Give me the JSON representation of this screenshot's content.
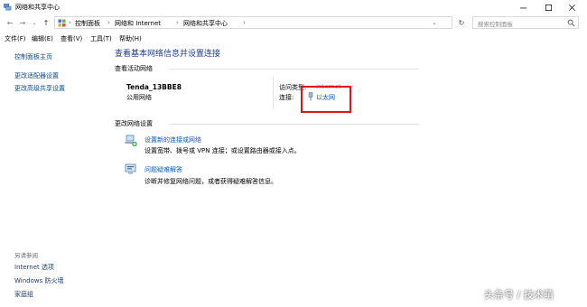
{
  "window": {
    "title": "网络和共享中心"
  },
  "address": {
    "crumbs": [
      "控制面板",
      "网络和 Internet",
      "网络和共享中心"
    ],
    "search_placeholder": "搜索控制面板"
  },
  "menu": {
    "items": [
      "文件(F)",
      "编辑(E)",
      "查看(V)",
      "工具(T)",
      "帮助(H)"
    ]
  },
  "sidebar": {
    "links": [
      "控制面板主页",
      "更改适配器设置",
      "更改高级共享设置"
    ],
    "see_also_heading": "另请参阅",
    "see_also": [
      "Internet 选项",
      "Windows 防火墙",
      "家庭组"
    ]
  },
  "main": {
    "title": "查看基本网络信息并设置连接",
    "active_heading": "查看活动网络",
    "network": {
      "name": "Tenda_13BBE8",
      "type": "公用网络",
      "access_label": "访问类型:",
      "access_value": "Internet",
      "conn_label": "连接:",
      "conn_value": "以太网"
    },
    "change_heading": "更改网络设置",
    "tasks": [
      {
        "icon": "network-setup-icon",
        "link": "设置新的连接或网络",
        "desc": "设置宽带、拨号或 VPN 连接；或设置路由器或接入点。"
      },
      {
        "icon": "troubleshoot-icon",
        "link": "问题疑难解答",
        "desc": "诊断并修复网络问题，或者获得疑难解答信息。"
      }
    ]
  },
  "watermark": "头条号 / 技术萌",
  "colors": {
    "link": "#0a5bb5",
    "title": "#1e3d8f",
    "highlight": "#e0141b"
  }
}
